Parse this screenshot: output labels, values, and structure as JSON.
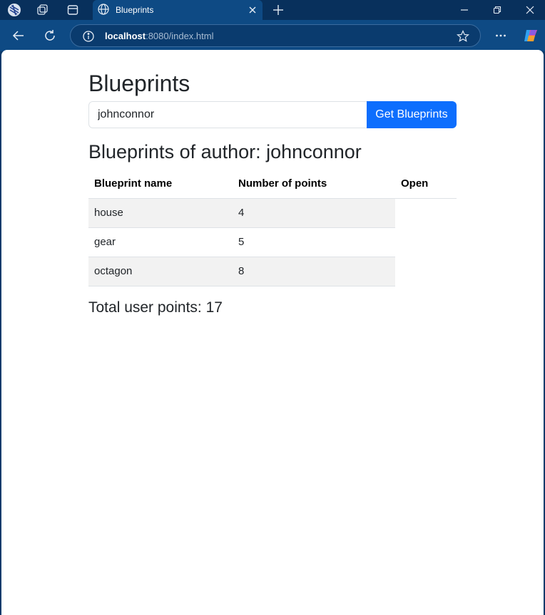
{
  "browser": {
    "tab_title": "Blueprints",
    "url_host": "localhost",
    "url_rest": ":8080/index.html"
  },
  "page": {
    "heading": "Blueprints",
    "search": {
      "value": "johnconnor",
      "button_label": "Get Blueprints"
    },
    "author_heading": "Blueprints of author: johnconnor",
    "table": {
      "headers": [
        "Blueprint name",
        "Number of points",
        "Open"
      ],
      "rows": [
        {
          "name": "house",
          "points": "4"
        },
        {
          "name": "gear",
          "points": "5"
        },
        {
          "name": "octagon",
          "points": "8"
        }
      ]
    },
    "total": "Total user points: 17"
  },
  "icons": {
    "workspaces": "workspaces-icon",
    "tab_actions": "tab-actions-icon",
    "vertical_tabs": "vertical-tabs-icon",
    "favicon": "globe-icon",
    "close": "close-icon",
    "new_tab": "plus-icon",
    "back": "back-arrow-icon",
    "refresh": "refresh-icon",
    "info": "info-icon",
    "favorite": "star-icon",
    "menu": "more-icon",
    "copilot": "copilot-icon"
  },
  "colors": {
    "titlebar": "#08305c",
    "toolbar": "#0e4a84",
    "primary_button": "#0d6efd",
    "row_stripe": "#f2f2f2"
  }
}
